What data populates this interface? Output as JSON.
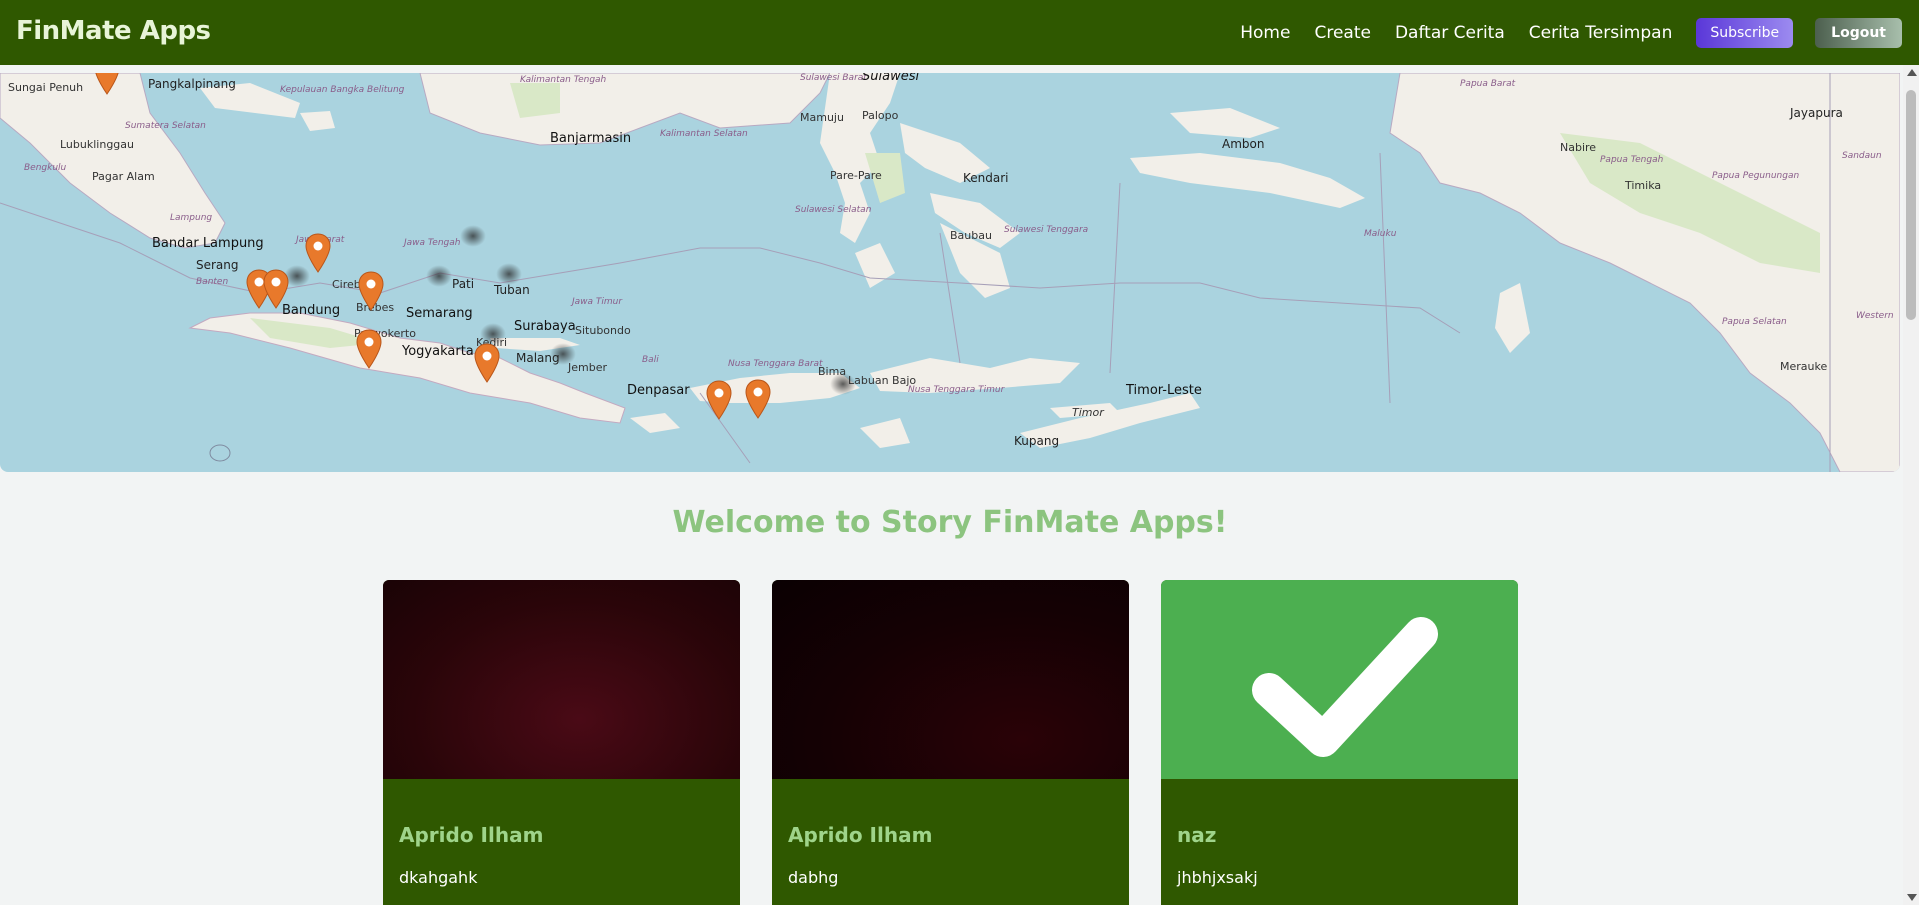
{
  "app": {
    "title": "FinMate Apps"
  },
  "nav": {
    "home": "Home",
    "create": "Create",
    "list": "Daftar Cerita",
    "saved": "Cerita Tersimpan",
    "subscribe": "Subscribe",
    "logout": "Logout"
  },
  "map": {
    "labels": {
      "sungai_penuh": "Sungai Penuh",
      "pangkalpinang": "Pangkalpinang",
      "kepulauan": "Kepulauan Bangka Belitung",
      "kalimantan_tengah": "Kalimantan Tengah",
      "sulawesi_barat": "Sulawesi Barat",
      "sulawesi": "Sulawesi",
      "papua_barat": "Papua Barat",
      "jayapura": "Jayapura",
      "sumatera_selatan": "Sumatera Selatan",
      "lubuklinggau": "Lubuklinggau",
      "banjarmasin": "Banjarmasin",
      "kalimantan_selatan": "Kalimantan Selatan",
      "mamuju": "Mamuju",
      "palopo": "Palopo",
      "ambon": "Ambon",
      "nabire": "Nabire",
      "papua_tengah": "Papua Tengah",
      "sandaun": "Sandaun",
      "bengkulu": "Bengkulu",
      "pagar_alam": "Pagar Alam",
      "pare_pare": "Pare-Pare",
      "kendari": "Kendari",
      "timika": "Timika",
      "papua_pegunungan": "Papua Pegunungan",
      "lampung": "Lampung",
      "sulawesi_selatan": "Sulawesi Selatan",
      "baubau": "Baubau",
      "sulawesi_tenggara": "Sulawesi Tenggara",
      "maluku": "Maluku",
      "bandar_lampung": "Bandar Lampung",
      "jawa_barat": "Jawa Barat",
      "jawa_tengah": "Jawa Tengah",
      "serang": "Serang",
      "banten": "Banten",
      "cirebon": "Cirebon",
      "pati": "Pati",
      "tuban": "Tuban",
      "bandung": "Bandung",
      "brebes": "Brebes",
      "semarang": "Semarang",
      "jawa_timur": "Jawa Timur",
      "surabaya": "Surabaya",
      "situbondo": "Situbondo",
      "papua_selatan": "Papua Selatan",
      "western": "Western",
      "purwokerto": "Purwokerto",
      "yogyakarta": "Yogyakarta",
      "kediri": "Kediri",
      "malang": "Malang",
      "jember": "Jember",
      "bali": "Bali",
      "ntb": "Nusa Tenggara Barat",
      "bima": "Bima",
      "labuan_bajo": "Labuan Bajo",
      "merauke": "Merauke",
      "denpasar": "Denpasar",
      "ntt": "Nusa Tenggara Timur",
      "timor_leste": "Timor-Leste",
      "timor": "Timor",
      "kupang": "Kupang"
    }
  },
  "welcome": "Welcome to Story FinMate Apps!",
  "stories": [
    {
      "name": "Aprido Ilham",
      "description": "dkahgahk",
      "image": "dark-red-photo"
    },
    {
      "name": "Aprido Ilham",
      "description": "dabhg",
      "image": "dark-photo"
    },
    {
      "name": "naz",
      "description": "jhbhjxsakj",
      "image": "check-icon"
    }
  ],
  "colors": {
    "navbar": "#2f5800",
    "accent_text": "#8cc47f",
    "card_name": "#9fd48a",
    "marker": "#e8792b",
    "sea": "#aad3df",
    "land": "#f2efe9"
  }
}
